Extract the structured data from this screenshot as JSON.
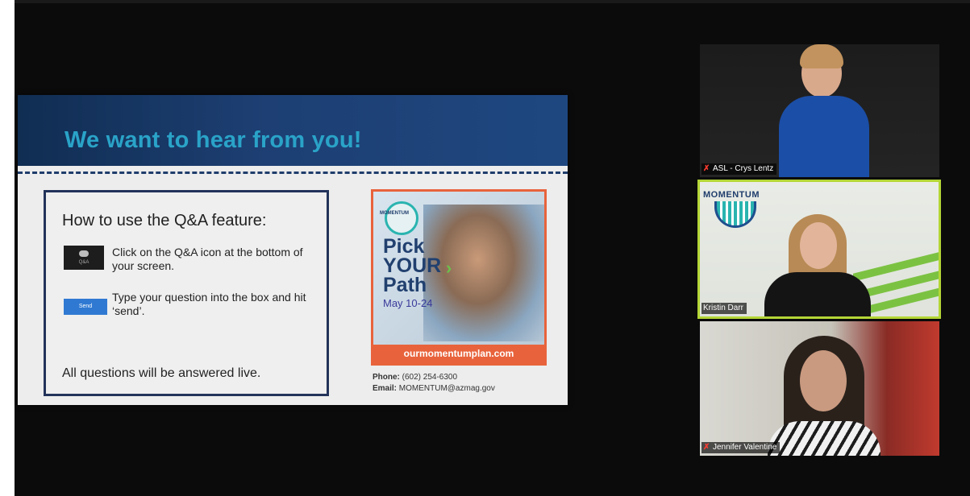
{
  "slide": {
    "title": "We want to hear from you!",
    "qa_heading": "How to use the Q&A feature:",
    "step1": "Click on the Q&A icon at the bottom of your screen.",
    "qa_icon_caption": "Q&A",
    "step2": "Type your question into the box and hit ‘send’.",
    "send_label": "Send",
    "footer": "All questions will be answered live.",
    "poster": {
      "logo": "MOMENTUM",
      "pick": "Pick",
      "your": "YOUR",
      "path": "Path",
      "date": "May 10-24",
      "url": "ourmomentumplan.com"
    },
    "contact": {
      "phone_label": "Phone:",
      "phone": " (602) 254-6300",
      "email_label": "Email:",
      "email": " MOMENTUM@azmag.gov"
    }
  },
  "participants": [
    {
      "name": "ASL - Crys Lentz",
      "muted": true
    },
    {
      "name": "Kristin Darr",
      "muted": false,
      "active_speaker": true,
      "background_logo": "MOMENTUM"
    },
    {
      "name": "Jennifer Valentine",
      "muted": true
    }
  ],
  "colors": {
    "active_speaker_border": "#b4d636",
    "slide_title": "#2aa3c8",
    "poster_accent": "#e8633c",
    "mute_icon": "#ff3b30"
  }
}
